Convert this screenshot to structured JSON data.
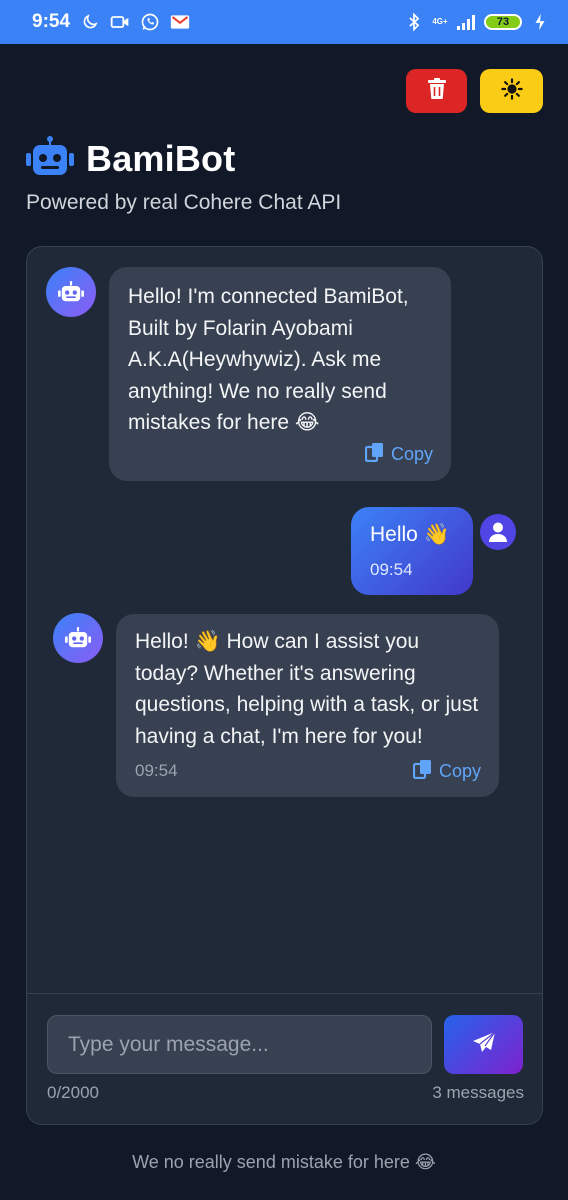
{
  "status_bar": {
    "time": "9:54",
    "network": "4G+",
    "battery": "73",
    "icons": [
      "moon-icon",
      "video-icon",
      "whatsapp-icon",
      "gmail-icon",
      "bluetooth-icon",
      "signal-icon",
      "charging-icon"
    ]
  },
  "header": {
    "title": "BamiBot",
    "subtitle": "Powered by real Cohere Chat API",
    "delete_icon": "trash-icon",
    "theme_icon": "sun-icon"
  },
  "messages": [
    {
      "role": "bot",
      "text": "Hello! I'm connected BamiBot, Built by Folarin Ayobami A.K.A(Heywhywiz). Ask me anything! We no really send mistakes for here 😂",
      "copy_label": "Copy"
    },
    {
      "role": "user",
      "text": "Hello 👋",
      "time": "09:54"
    },
    {
      "role": "bot",
      "text": "Hello! 👋 How can I assist you today? Whether it's answering questions, helping with a task, or just having a chat, I'm here for you!",
      "time": "09:54",
      "copy_label": "Copy"
    }
  ],
  "input": {
    "placeholder": "Type your message...",
    "char_count": "0/2000",
    "message_count": "3 messages",
    "send_icon": "paper-plane-icon"
  },
  "footer": {
    "text": "We no really send mistake for here 😂"
  },
  "colors": {
    "background": "#111827",
    "card": "#1f2937",
    "status_bar": "#3b82f6",
    "delete_button": "#dc2626",
    "theme_button": "#facc15",
    "accent": "#60a5fa"
  }
}
